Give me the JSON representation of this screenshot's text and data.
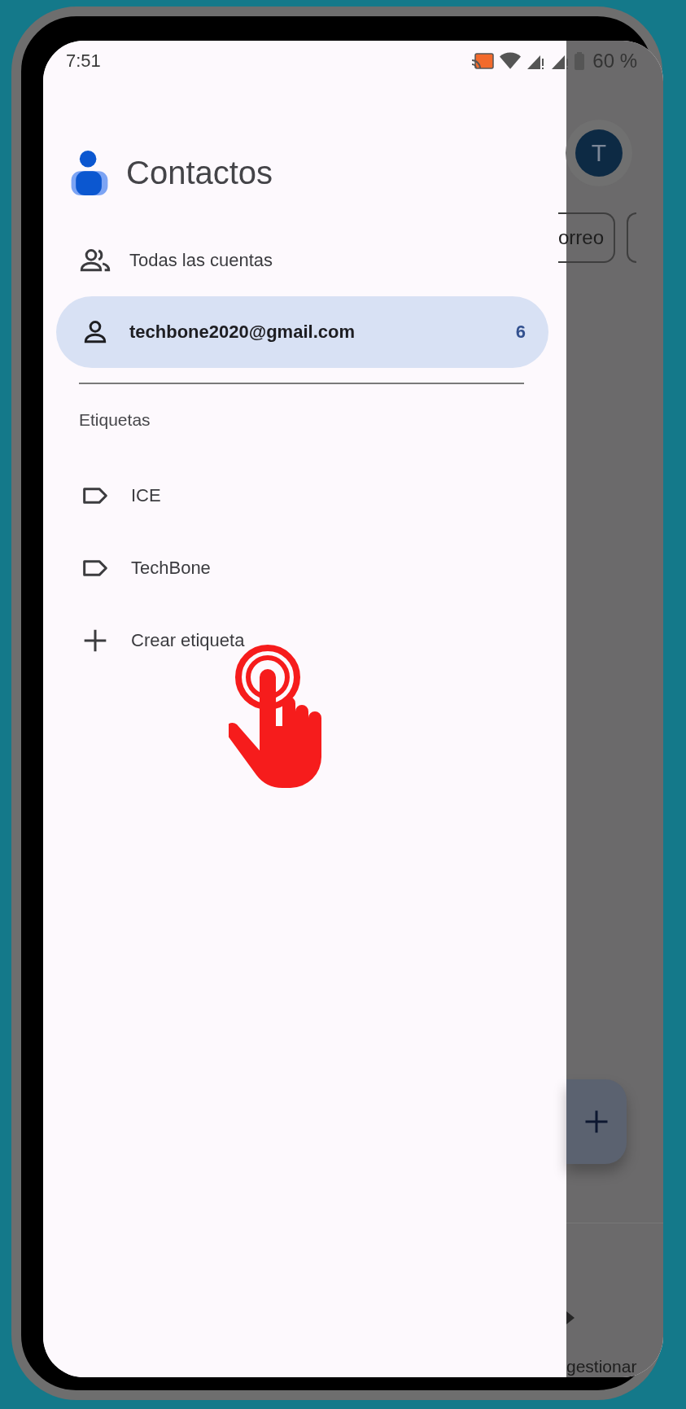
{
  "status_bar": {
    "time": "7:51",
    "battery": "60 %"
  },
  "drawer": {
    "app_title": "Contactos",
    "accounts": [
      {
        "kind": "people",
        "label": "Todas las cuentas",
        "selected": false
      },
      {
        "kind": "person",
        "label": "techbone2020@gmail.com",
        "count": "6",
        "selected": true
      }
    ],
    "labels_heading": "Etiquetas",
    "labels": [
      {
        "label": "ICE"
      },
      {
        "label": "TechBone"
      }
    ],
    "create_label": "Crear etiqueta"
  },
  "background": {
    "avatar": "T",
    "chip": "orreo",
    "bottom_label": "gestionar"
  }
}
